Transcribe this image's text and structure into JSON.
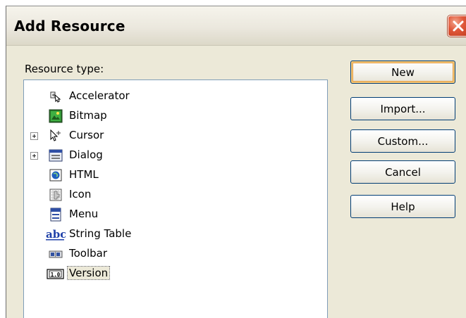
{
  "window": {
    "title": "Add Resource",
    "close_icon": "close-icon"
  },
  "resource_type": {
    "label": "Resource type:",
    "items": [
      {
        "label": "Accelerator",
        "icon": "accelerator-icon",
        "expandable": false
      },
      {
        "label": "Bitmap",
        "icon": "bitmap-icon",
        "expandable": false
      },
      {
        "label": "Cursor",
        "icon": "cursor-icon",
        "expandable": true
      },
      {
        "label": "Dialog",
        "icon": "dialog-icon",
        "expandable": true
      },
      {
        "label": "HTML",
        "icon": "html-icon",
        "expandable": false
      },
      {
        "label": "Icon",
        "icon": "icon-resource-icon",
        "expandable": false
      },
      {
        "label": "Menu",
        "icon": "menu-icon",
        "expandable": false
      },
      {
        "label": "String Table",
        "icon": "string-table-icon",
        "expandable": false
      },
      {
        "label": "Toolbar",
        "icon": "toolbar-icon",
        "expandable": false
      },
      {
        "label": "Version",
        "icon": "version-icon",
        "expandable": false,
        "selected": true
      }
    ]
  },
  "buttons": {
    "new_label": "New",
    "import_label": "Import...",
    "custom_label": "Custom...",
    "cancel_label": "Cancel",
    "help_label": "Help"
  },
  "icon_text": {
    "string_table": "abc",
    "version": "1.0"
  },
  "colors": {
    "dialog_background": "#ece9d8",
    "close_button": "#e0583a",
    "default_button_highlight": "#f6c674",
    "listbox_border": "#7f9db9"
  }
}
